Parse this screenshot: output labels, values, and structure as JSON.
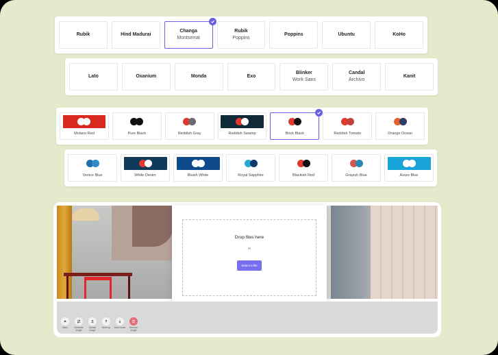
{
  "fonts_row1": [
    {
      "name": "Rubik",
      "sub": ""
    },
    {
      "name": "Hind Madurai",
      "sub": ""
    },
    {
      "name": "Changa",
      "sub": "Montserrat",
      "selected": true
    },
    {
      "name": "Rubik",
      "sub": "Poppins"
    },
    {
      "name": "Poppins",
      "sub": ""
    },
    {
      "name": "Ubuntu",
      "sub": ""
    },
    {
      "name": "KoHo",
      "sub": ""
    }
  ],
  "fonts_row2": [
    {
      "name": "Lato",
      "sub": ""
    },
    {
      "name": "Oxanium",
      "sub": ""
    },
    {
      "name": "Monda",
      "sub": ""
    },
    {
      "name": "Exo",
      "sub": ""
    },
    {
      "name": "Blinker",
      "sub": "Work Sans"
    },
    {
      "name": "Candal",
      "sub": "Archivo"
    },
    {
      "name": "Kanit",
      "sub": ""
    }
  ],
  "colors_row1": [
    {
      "label": "Molano Red",
      "bg": "#d9291f",
      "dots": [
        "#ffffff",
        "#ffffff"
      ]
    },
    {
      "label": "Pure Black",
      "bg": "#ffffff",
      "dots": [
        "#111111",
        "#111111"
      ]
    },
    {
      "label": "Reddish Gray",
      "bg": "#ffffff",
      "dots": [
        "#e0392f",
        "#6b6b6b"
      ]
    },
    {
      "label": "Reddish Swamp",
      "bg": "#0f2a36",
      "dots": [
        "#e0392f",
        "#ffffff"
      ]
    },
    {
      "label": "Brick Black",
      "bg": "#ffffff",
      "dots": [
        "#e0392f",
        "#111111"
      ],
      "selected": true
    },
    {
      "label": "Reddish Tomato",
      "bg": "#ffffff",
      "dots": [
        "#e0392f",
        "#c1443a"
      ]
    },
    {
      "label": "Orange Ocean",
      "bg": "#ffffff",
      "dots": [
        "#e6622b",
        "#2b3d6b"
      ]
    }
  ],
  "colors_row2": [
    {
      "label": "Venice Blue",
      "bg": "#ffffff",
      "dots": [
        "#1c6fa8",
        "#2b8cc8"
      ]
    },
    {
      "label": "White Denim",
      "bg": "#0f3a5a",
      "dots": [
        "#e0392f",
        "#ffffff"
      ]
    },
    {
      "label": "Bluish White",
      "bg": "#0f4a8a",
      "dots": [
        "#ffffff",
        "#ffffff"
      ]
    },
    {
      "label": "Royal Sapphire",
      "bg": "#ffffff",
      "dots": [
        "#25a7d8",
        "#0f3a6a"
      ]
    },
    {
      "label": "Blackish Red",
      "bg": "#ffffff",
      "dots": [
        "#e0392f",
        "#111111"
      ]
    },
    {
      "label": "Grayish Blue",
      "bg": "#ffffff",
      "dots": [
        "#d0584f",
        "#2a86b8"
      ]
    },
    {
      "label": "Azure Blue",
      "bg": "#18a4d6",
      "dots": [
        "#ffffff",
        "#ffffff"
      ]
    }
  ],
  "upload": {
    "title": "Drop files here",
    "or": "or",
    "button": "Select a file"
  },
  "toolbar": [
    {
      "label": "Back",
      "icon": "back-icon"
    },
    {
      "label": "Generate image",
      "icon": "shuffle-icon"
    },
    {
      "label": "Upload image",
      "icon": "upload-icon"
    },
    {
      "label": "Move up",
      "icon": "arrow-up-icon"
    },
    {
      "label": "Move down",
      "icon": "arrow-down-icon"
    },
    {
      "label": "Remove image",
      "icon": "trash-icon",
      "danger": true
    }
  ],
  "accent_color": "#6a5ee0",
  "background_color": "#e4ebcd"
}
